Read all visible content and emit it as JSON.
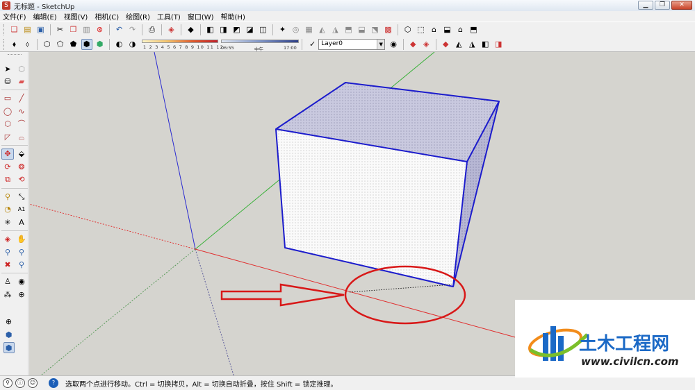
{
  "window": {
    "title": "无标题 - SketchUp",
    "app_icon": "sketchup-icon",
    "buttons": [
      "minimize",
      "maximize",
      "close"
    ]
  },
  "menu": [
    "文件(F)",
    "编辑(E)",
    "视图(V)",
    "相机(C)",
    "绘图(R)",
    "工具(T)",
    "窗口(W)",
    "帮助(H)"
  ],
  "toolbar1": {
    "icons": [
      "new-file-icon",
      "open-file-icon",
      "save-icon",
      "cut-icon",
      "copy-icon",
      "paste-icon",
      "erase-icon",
      "undo-icon",
      "redo-icon",
      "print-icon",
      "model-info-icon",
      "component-icon",
      "camera-icon",
      "x-ray-icon",
      "back-edges-icon",
      "section-icon",
      "section-cut-icon",
      "shadows-icon",
      "fog-icon",
      "sandbox-icon",
      "smoove-icon",
      "stamp-icon",
      "drape-icon",
      "add-detail-icon",
      "flip-edge-icon",
      "film-icon",
      "iso-view-icon",
      "top-view-icon",
      "front-view-icon",
      "right-view-icon",
      "back-view-icon",
      "left-view-icon"
    ]
  },
  "toolbar2": {
    "shadow_ticks": "1 2 3 4 5 6 7 8 9 10 11 12",
    "time_start": "06:55",
    "time_mid": "中午",
    "time_end": "17:00",
    "layer_check": "✓",
    "layer_name": "Layer0",
    "icons": [
      "xray-style-icon",
      "back-edges-style-icon",
      "wireframe-style-icon",
      "hidden-line-style-icon",
      "shaded-style-icon",
      "textured-style-icon",
      "monochrome-style-icon",
      "shadow-settings-icon",
      "shadow-toggle-icon",
      "layer-manager-icon",
      "scene-icon",
      "follow-me-icon",
      "offset-icon",
      "push-pull-icon",
      "outliner-icon",
      "materials-icon"
    ]
  },
  "left_tools": [
    "select-icon",
    "make-component-icon",
    "paint-bucket-icon",
    "eraser-icon",
    "rectangle-icon",
    "line-icon",
    "circle-icon",
    "freehand-icon",
    "polygon-icon",
    "arc-icon",
    "pie-icon",
    "two-point-arc-icon",
    "move-icon",
    "push-pull-icon",
    "rotate-icon",
    "follow-me-icon",
    "scale-icon",
    "offset-icon",
    "tape-measure-icon",
    "dimension-icon",
    "protractor-icon",
    "text-icon",
    "axes-icon",
    "3d-text-icon",
    "orbit-icon",
    "pan-icon",
    "zoom-icon",
    "zoom-window-icon",
    "zoom-extents-icon",
    "previous-view-icon",
    "position-camera-icon",
    "look-around-icon",
    "walk-icon",
    "section-plane-icon",
    "nav-compass-icon",
    "orbit-3d-icon",
    "component-2-icon"
  ],
  "status": {
    "icons": [
      "geo-location-icon",
      "credits-icon",
      "user-icon",
      "help-icon"
    ],
    "message": "选取两个点进行移动。Ctrl = 切换拷贝，Alt = 切换自动折叠，按住 Shift = 锁定推理。"
  },
  "colors": {
    "viewport": "#d5d4cf",
    "axis_red": "#e03030",
    "axis_green": "#38b038",
    "axis_blue": "#2a2ad0",
    "edge_blue": "#1c1ccc",
    "annotation_red": "#d81818"
  },
  "watermark": {
    "brand": "土木工程网",
    "url": "www.civilcn.com"
  }
}
